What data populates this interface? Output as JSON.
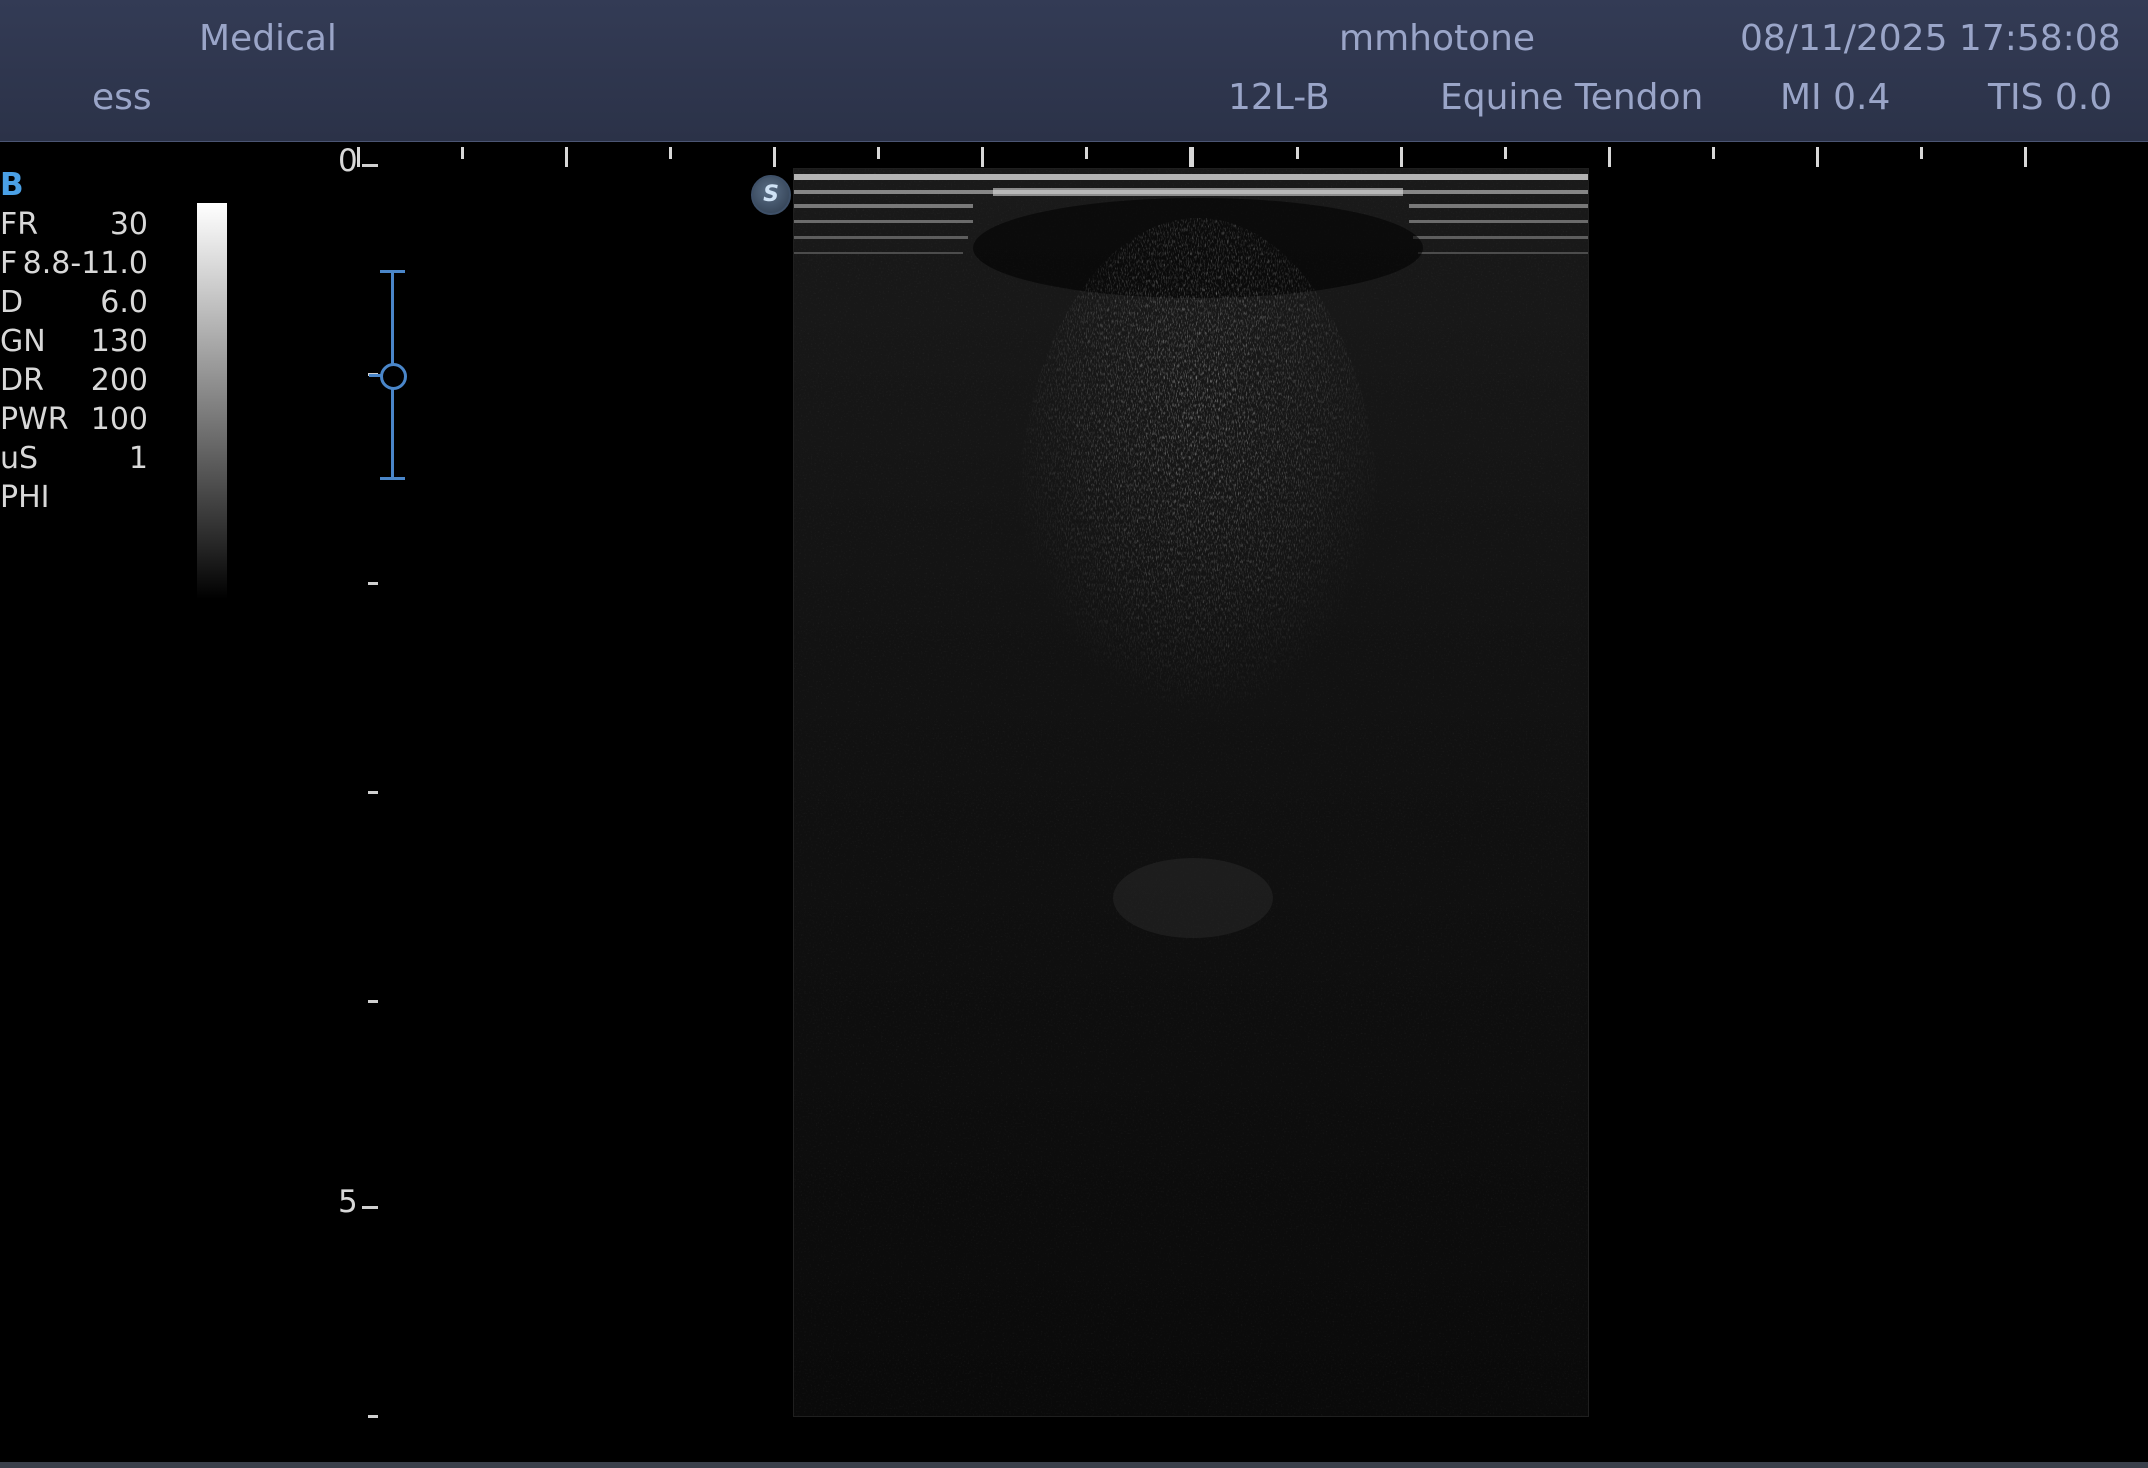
{
  "header": {
    "institution": "Medical",
    "operator": "ess",
    "brand": "mmhotone",
    "datetime": "08/11/2025 17:58:08",
    "probe": "12L-B",
    "preset": "Equine Tendon",
    "mi": "MI 0.4",
    "tis": "TIS 0.0"
  },
  "params": {
    "mode": "B",
    "rows": [
      {
        "key": "FR",
        "value": "30"
      },
      {
        "key": "F",
        "value": "8.8-11.0"
      },
      {
        "key": "D",
        "value": "6.0"
      },
      {
        "key": "GN",
        "value": "130"
      },
      {
        "key": "DR",
        "value": "200"
      },
      {
        "key": "PWR",
        "value": "100"
      },
      {
        "key": "uS",
        "value": "1"
      },
      {
        "key": "PHI",
        "value": ""
      }
    ]
  },
  "depth_scale": {
    "labels": [
      "0",
      "5"
    ]
  },
  "image": {
    "badge": "S"
  },
  "colors": {
    "header_bg": "#2b3248",
    "header_text": "#9aa5c8",
    "mode_accent": "#4aa0e6",
    "focus_marker": "#4a86c9"
  },
  "icons": {
    "badge_icon": "s-circle-icon",
    "focus_icon": "focus-marker-icon"
  }
}
